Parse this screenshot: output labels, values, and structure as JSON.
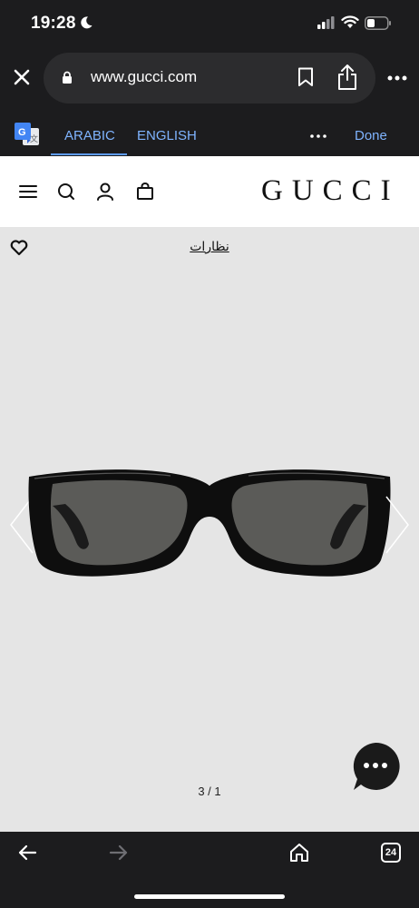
{
  "status": {
    "time": "19:28"
  },
  "browser": {
    "url": "www.gucci.com"
  },
  "translate": {
    "lang_source": "ARABIC",
    "lang_target": "ENGLISH",
    "done_label": "Done"
  },
  "site": {
    "logo_text": "GUCCI"
  },
  "product": {
    "category_link": "نظارات",
    "pager": "3 / 1"
  },
  "toolbar": {
    "tab_count": "24"
  },
  "colors": {
    "chrome_bg": "#1c1c1e",
    "url_pill_bg": "#2c2c2e",
    "accent_link": "#7fb4ff",
    "product_bg": "#e5e5e5",
    "chat_button": "#1a1a1a"
  },
  "icons": [
    "moon-icon",
    "signal-icon",
    "wifi-icon",
    "battery-icon",
    "close-icon",
    "lock-icon",
    "bookmark-icon",
    "share-icon",
    "more-icon",
    "google-translate-icon",
    "menu-icon",
    "search-icon",
    "account-icon",
    "shopping-bag-icon",
    "wishlist-heart-icon",
    "chevron-left-icon",
    "chevron-right-icon",
    "chat-icon",
    "back-arrow-icon",
    "forward-arrow-icon",
    "home-icon"
  ]
}
